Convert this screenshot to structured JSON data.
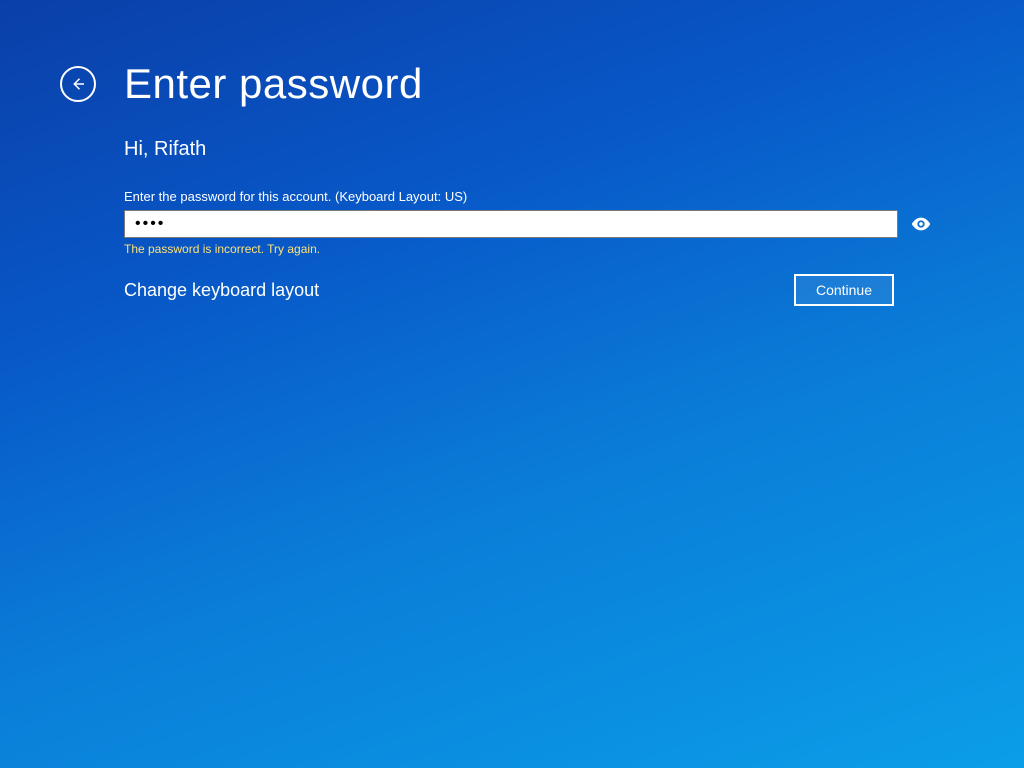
{
  "title": "Enter password",
  "greeting": "Hi, Rifath",
  "instruction": "Enter the password for this account. (Keyboard Layout: US)",
  "password_value": "••••",
  "error_message": "The password is incorrect. Try again.",
  "change_keyboard_label": "Change keyboard layout",
  "continue_label": "Continue"
}
